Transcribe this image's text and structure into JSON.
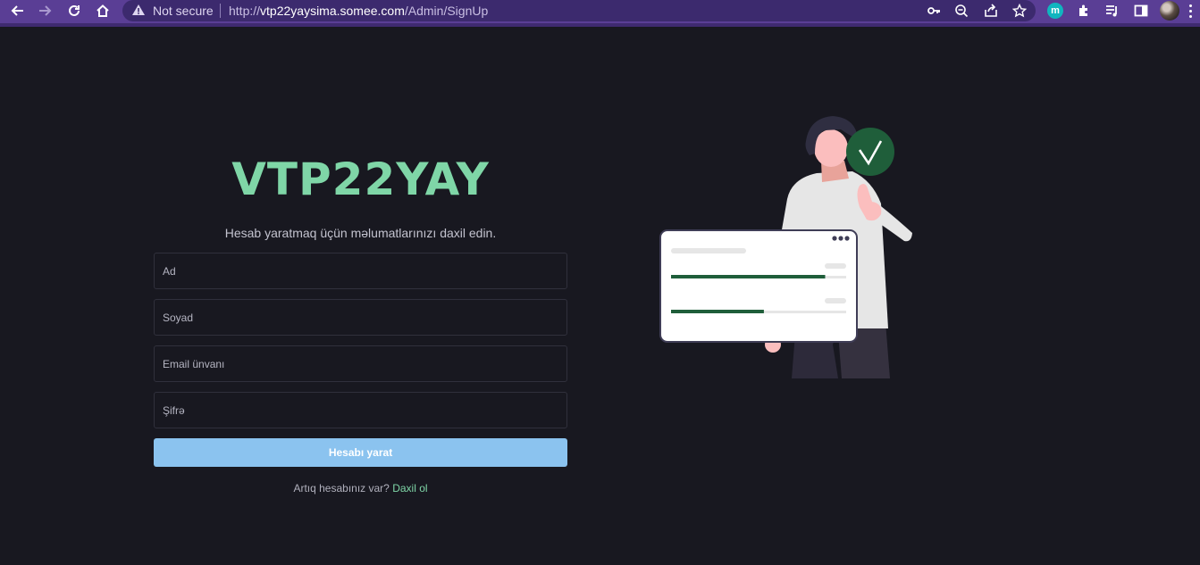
{
  "browser": {
    "security_label": "Not secure",
    "url_prefix": "http://",
    "url_host": "vtp22yaysima.somee.com",
    "url_path": "/Admin/SignUp",
    "extension_badge": "m",
    "icons": [
      "back-icon",
      "forward-icon",
      "reload-icon",
      "home-icon",
      "warning-icon",
      "key-icon",
      "zoom-out-icon",
      "share-icon",
      "star-icon",
      "extensions-icon",
      "media-icon",
      "side-panel-icon",
      "kebab-menu-icon"
    ]
  },
  "page": {
    "brand": "VTP22YAY",
    "subtitle": "Hesab yaratmaq üçün məlumatlarınızı daxil edin.",
    "fields": {
      "first_name": "Ad",
      "last_name": "Soyad",
      "email": "Email ünvanı",
      "password": "Şifrə"
    },
    "submit_label": "Hesabı yarat",
    "login_prompt": "Artıq hesabınız var?",
    "login_link": "Daxil ol"
  },
  "colors": {
    "background": "#181820",
    "browser_frame": "#5a3e95",
    "brand": "#7fd6a7",
    "button": "#8bc3ef",
    "check_badge": "#1f5e3a",
    "progress_fill": "#1f5e3a"
  },
  "illustration": {
    "progress_levels": [
      0.88,
      0.53
    ]
  }
}
